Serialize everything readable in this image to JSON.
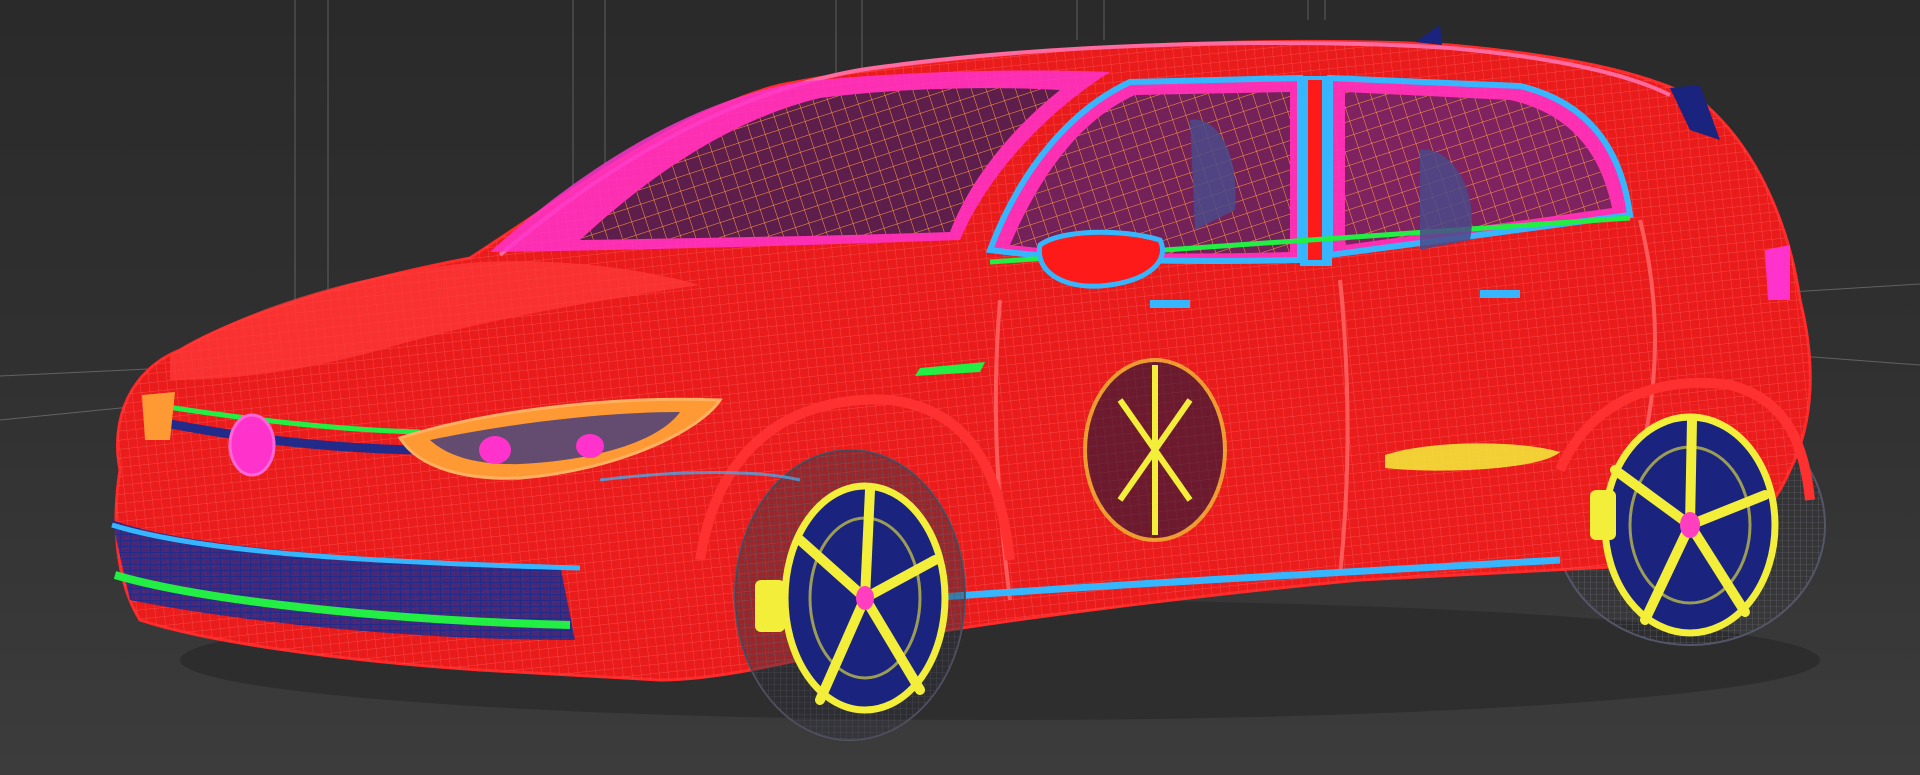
{
  "viewport": {
    "mode": "wireframe",
    "background": "#2e2e2e",
    "grid_color": "#8a8a8a"
  },
  "scene": {
    "subject": "car",
    "body_style": "hatchback",
    "doors": 5,
    "wheel_style": "five-spoke"
  },
  "palette": {
    "body": "#ff1a1a",
    "windows": "#ff33cc",
    "window_grid": "#ff9a3c",
    "trim": "#36b6ff",
    "accent_green": "#22ee44",
    "headlight": "#ff9933",
    "wheel_spoke": "#f2ee3a",
    "wheel_hub": "#1a237e",
    "wheel_center": "#ff3fbf",
    "tire_wire": "#6a6a7a",
    "interior": "#222a8a"
  }
}
